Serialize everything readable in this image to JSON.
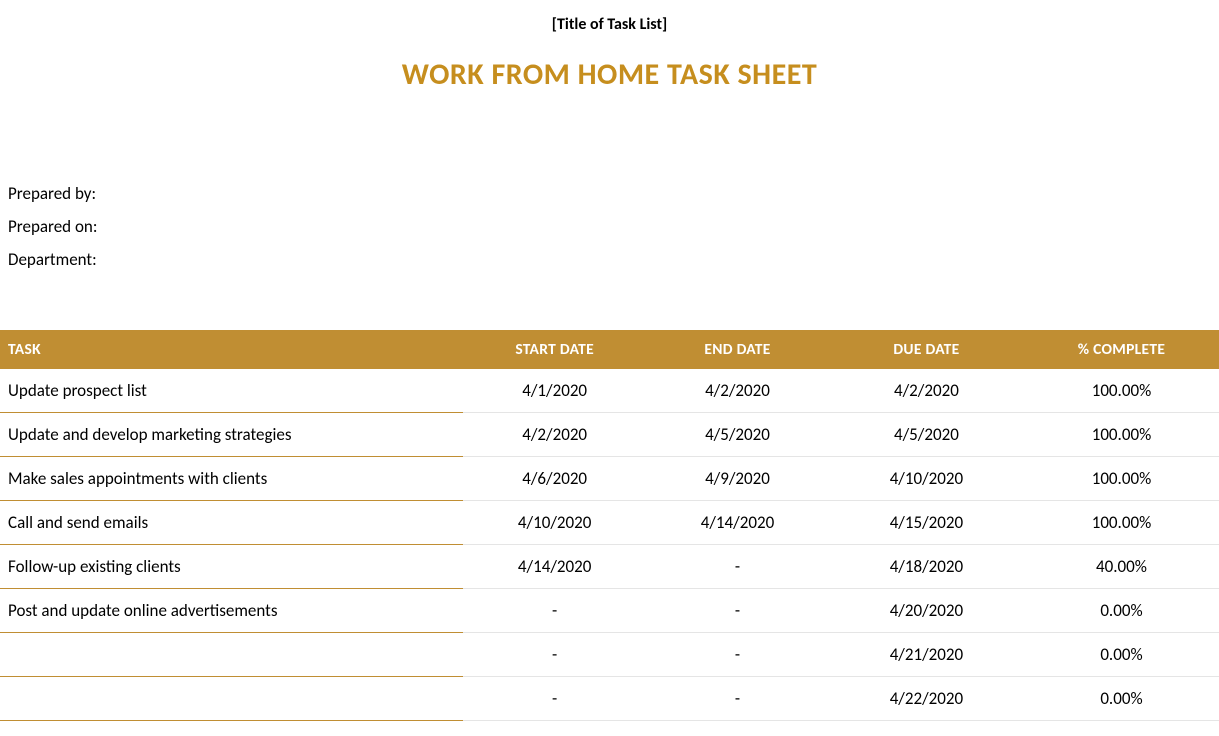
{
  "header": {
    "title_placeholder": "[Title of Task List]",
    "main_title": "WORK FROM HOME TASK SHEET"
  },
  "meta": {
    "prepared_by_label": "Prepared by:",
    "prepared_on_label": "Prepared on:",
    "department_label": "Department:"
  },
  "table": {
    "headers": {
      "task": "TASK",
      "start_date": "START DATE",
      "end_date": "END DATE",
      "due_date": "DUE DATE",
      "complete": "% COMPLETE"
    },
    "rows": [
      {
        "task": "Update prospect list",
        "start": "4/1/2020",
        "end": "4/2/2020",
        "due": "4/2/2020",
        "complete": "100.00%"
      },
      {
        "task": "Update and develop marketing strategies",
        "start": "4/2/2020",
        "end": "4/5/2020",
        "due": "4/5/2020",
        "complete": "100.00%"
      },
      {
        "task": "Make sales appointments with clients",
        "start": "4/6/2020",
        "end": "4/9/2020",
        "due": "4/10/2020",
        "complete": "100.00%"
      },
      {
        "task": "Call and send emails",
        "start": "4/10/2020",
        "end": "4/14/2020",
        "due": "4/15/2020",
        "complete": "100.00%"
      },
      {
        "task": "Follow-up existing clients",
        "start": "4/14/2020",
        "end": "-",
        "due": "4/18/2020",
        "complete": "40.00%"
      },
      {
        "task": "Post and update online advertisements",
        "start": "-",
        "end": "-",
        "due": "4/20/2020",
        "complete": "0.00%"
      },
      {
        "task": "",
        "start": "-",
        "end": "-",
        "due": "4/21/2020",
        "complete": "0.00%"
      },
      {
        "task": "",
        "start": "-",
        "end": "-",
        "due": "4/22/2020",
        "complete": "0.00%"
      }
    ]
  }
}
